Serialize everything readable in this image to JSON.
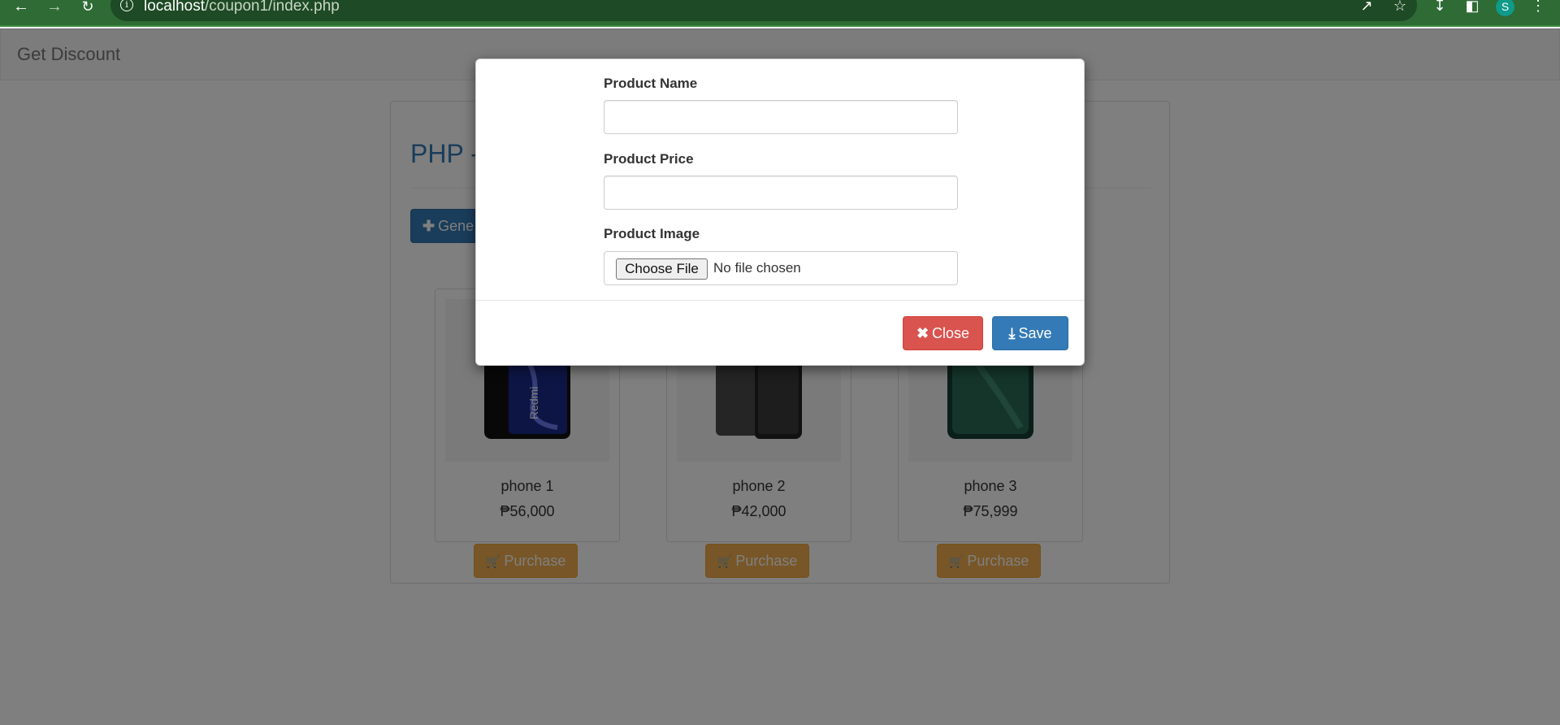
{
  "browser": {
    "url_host": "localhost",
    "url_path": "/coupon1/index.php",
    "profile_initial": "S"
  },
  "navbar": {
    "brand": "Get Discount"
  },
  "panel": {
    "title": "PHP -",
    "generate_label": "Gene"
  },
  "products": [
    {
      "name": "phone 1",
      "price": "₱56,000",
      "purchase_label": "Purchase",
      "phone_color": "#111111",
      "accent": "#3b4cc4"
    },
    {
      "name": "phone 2",
      "price": "₱42,000",
      "purchase_label": "Purchase",
      "phone_color": "#3a3a3a",
      "accent": "#555555"
    },
    {
      "name": "phone 3",
      "price": "₱75,999",
      "purchase_label": "Purchase",
      "phone_color": "#1e5a4a",
      "accent": "#2f7a62"
    }
  ],
  "modal": {
    "name_label": "Product Name",
    "name_value": "",
    "price_label": "Product Price",
    "price_value": "",
    "image_label": "Product Image",
    "choose_file_label": "Choose File",
    "file_status": "No file chosen",
    "close_label": "Close",
    "save_label": "Save"
  },
  "colors": {
    "primary": "#337ab7",
    "danger": "#d9534f",
    "warning": "#f0ad4e",
    "browser_green": "#2e6b35"
  },
  "icons": {
    "plus": "plus-icon",
    "cart": "shopping-cart-icon",
    "close": "times-icon",
    "save": "download-icon"
  }
}
